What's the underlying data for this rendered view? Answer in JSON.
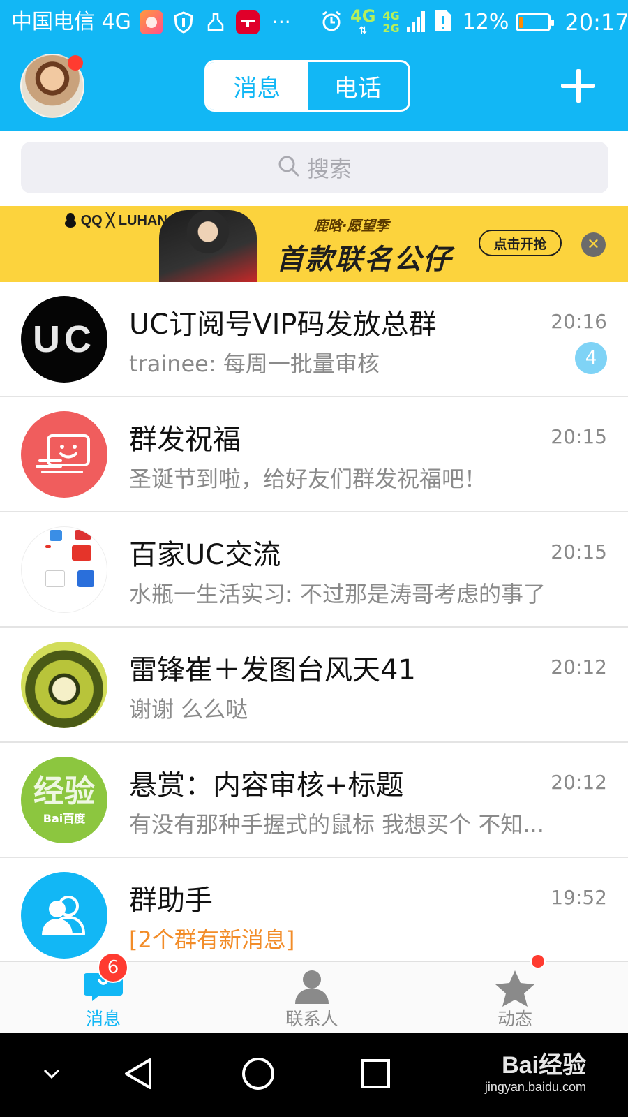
{
  "status_bar": {
    "carrier": "中国电信 4G",
    "network_top": "4G",
    "network_badge": "4G",
    "network_badge2": "2G",
    "battery_percent": "12%",
    "battery_level": 0.12,
    "time": "20:17",
    "overflow": "···",
    "app_icons": [
      "taobao-mini-app-icon",
      "shield-app-icon",
      "cleaner-app-icon",
      "tmall-app-icon"
    ]
  },
  "header": {
    "tabs": [
      {
        "label": "消息",
        "active": true
      },
      {
        "label": "电话",
        "active": false
      }
    ],
    "has_notification_dot": true
  },
  "search": {
    "placeholder": "搜索"
  },
  "banner": {
    "brand": "QQ ╳ LUHAN",
    "subtitle": "鹿晗·愿望季",
    "headline": "首款联名公仔",
    "cta": "点击开抢",
    "close": "✕",
    "background": "#fcd33d"
  },
  "conversations": [
    {
      "title": "UC订阅号VIP码发放总群",
      "time": "20:16",
      "preview": "trainee: 每周一批量审核",
      "unread": "4",
      "avatar_text": "UC"
    },
    {
      "title": "群发祝福",
      "time": "20:15",
      "preview": "圣诞节到啦，给好友们群发祝福吧！"
    },
    {
      "title": "百家UC交流",
      "time": "20:15",
      "preview": "水瓶一生活实习: 不过那是涛哥考虑的事了"
    },
    {
      "title": "雷锋崔＋发图台风天41",
      "time": "20:12",
      "preview": "谢谢 么么哒"
    },
    {
      "title": "悬赏：内容审核+标题",
      "time": "20:12",
      "preview": "有没有那种手握式的鼠标 我想买个 不知...",
      "avatar_text": "经验",
      "avatar_sub": "Bai百度"
    },
    {
      "title": "群助手",
      "time": "19:52",
      "preview": "[2个群有新消息]"
    }
  ],
  "tabbar": {
    "items": [
      {
        "label": "消息",
        "badge": "6",
        "active": true
      },
      {
        "label": "联系人",
        "active": false
      },
      {
        "label": "动态",
        "active": false,
        "dot": true
      }
    ],
    "active_color": "#12b7f5",
    "inactive_color": "#8a8a8a"
  },
  "watermark": {
    "main": "Bai经验",
    "sub": "jingyan.baidu.com"
  },
  "colors": {
    "accent": "#12b7f5",
    "unread_badge": "#7fd3f6",
    "alert": "#ff3b30",
    "highlight_text": "#f28c28"
  }
}
